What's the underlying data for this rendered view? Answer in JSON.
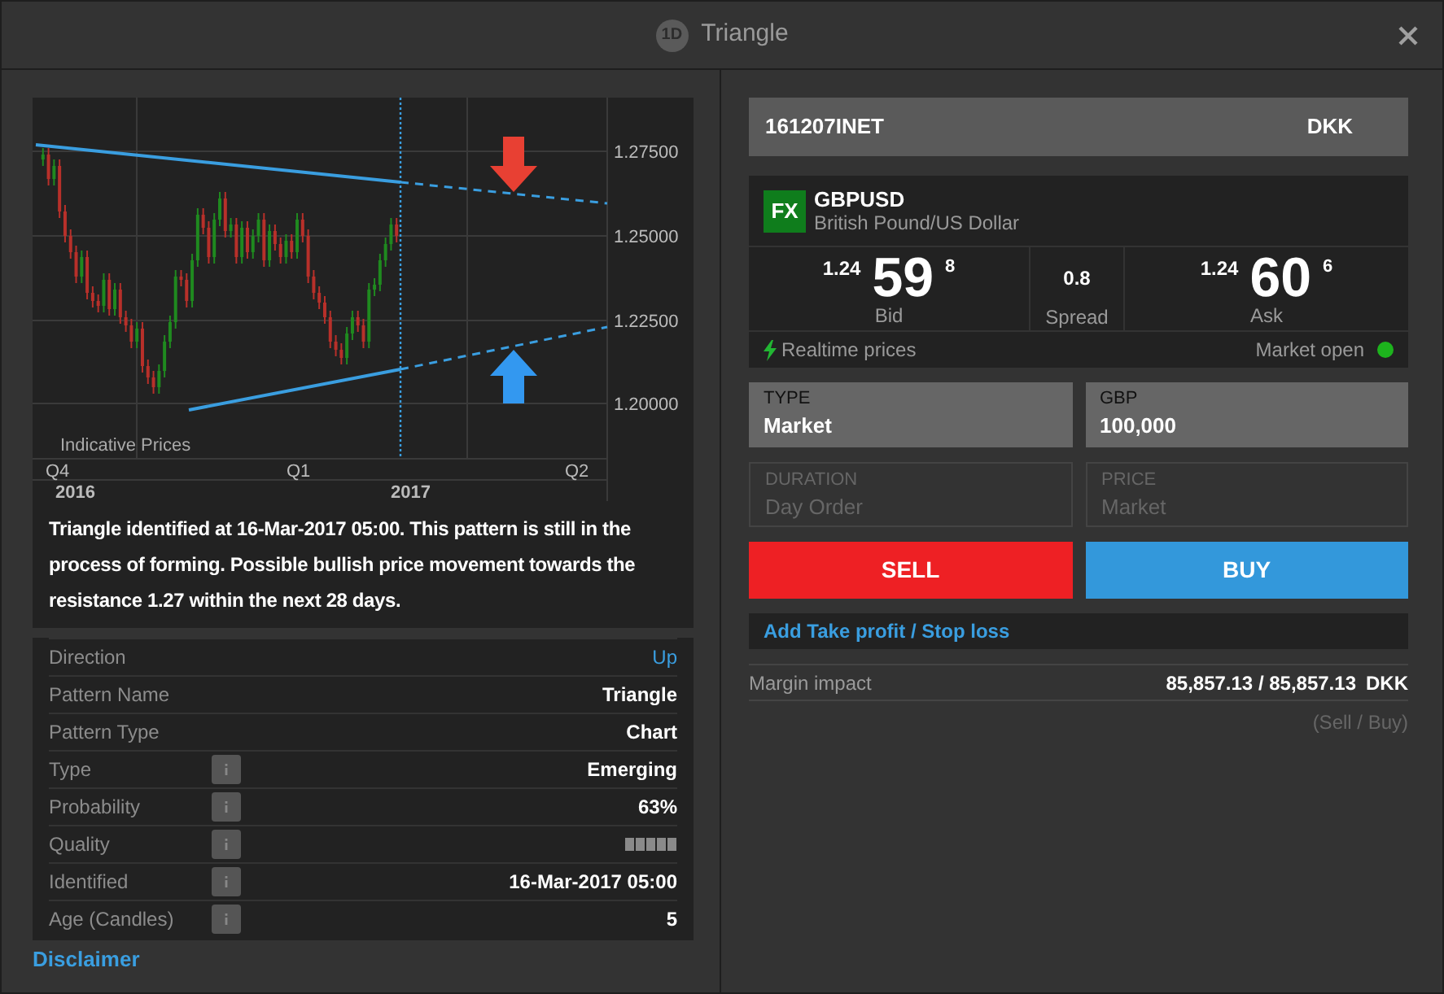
{
  "window": {
    "badge": "1D",
    "title": "Triangle"
  },
  "chart": {
    "y_labels": [
      "1.27500",
      "1.25000",
      "1.22500",
      "1.20000"
    ],
    "note": "Indicative Prices",
    "quarters": [
      "Q4",
      "Q1",
      "Q2"
    ],
    "years": [
      "2016",
      "2017"
    ]
  },
  "description": "Triangle identified at 16-Mar-2017 05:00. This pattern is still in the process of forming. Possible bullish price movement towards the resistance 1.27 within the next 28 days.",
  "details": [
    {
      "label": "Direction",
      "value": "Up",
      "info": false,
      "kind": "direction"
    },
    {
      "label": "Pattern Name",
      "value": "Triangle",
      "info": false,
      "kind": "text"
    },
    {
      "label": "Pattern Type",
      "value": "Chart",
      "info": false,
      "kind": "text"
    },
    {
      "label": "Type",
      "value": "Emerging",
      "info": true,
      "kind": "text"
    },
    {
      "label": "Probability",
      "value": "63%",
      "info": true,
      "kind": "text"
    },
    {
      "label": "Quality",
      "info": true,
      "kind": "bars"
    },
    {
      "label": "Identified",
      "value": "16-Mar-2017 05:00",
      "info": true,
      "kind": "text"
    },
    {
      "label": "Age (Candles)",
      "value": "5",
      "info": true,
      "kind": "text"
    }
  ],
  "disclaimer": "Disclaimer",
  "account": {
    "id": "161207INET",
    "currency": "DKK"
  },
  "instrument": {
    "badge": "FX",
    "symbol": "GBPUSD",
    "name": "British Pound/US Dollar"
  },
  "bid": {
    "prefix": "1.24",
    "pips": "59",
    "fraction": "8",
    "label": "Bid"
  },
  "spread": {
    "value": "0.8",
    "label": "Spread"
  },
  "ask": {
    "prefix": "1.24",
    "pips": "60",
    "fraction": "6",
    "label": "Ask"
  },
  "realtime": "Realtime prices",
  "market": {
    "label": "Market open",
    "open": true
  },
  "fields": [
    {
      "label": "TYPE",
      "value": "Market",
      "disabled": false
    },
    {
      "label": "GBP",
      "value": "100,000",
      "disabled": false
    },
    {
      "label": "DURATION",
      "value": "Day Order",
      "disabled": true
    },
    {
      "label": "PRICE",
      "value": "Market",
      "disabled": true
    }
  ],
  "sell": "SELL",
  "buy": "BUY",
  "take_profit_link": "Add Take profit / Stop loss",
  "margin": {
    "label": "Margin impact",
    "value": "85,857.13 / 85,857.13",
    "currency": "DKK",
    "note": "(Sell / Buy)"
  }
}
